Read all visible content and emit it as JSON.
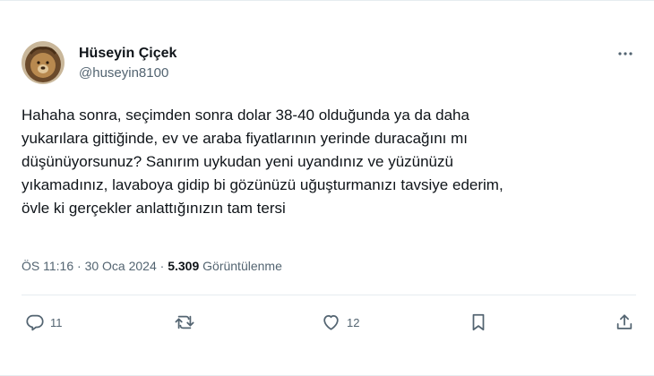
{
  "author": {
    "display_name": "Hüseyin Çiçek",
    "handle": "@huseyin8100",
    "avatar_icon": "lion-avatar"
  },
  "tweet": {
    "text": "Hahaha sonra, seçimden sonra dolar 38-40 olduğunda ya da daha\nyukarılara gittiğinde, ev ve araba fiyatlarının yerinde duracağını mı\ndüşünüyorsunuz? Sanırım uykudan yeni uyandınız ve yüzünüzü\nyıkamadınız, lavaboya gidip bi gözünüzü uğuşturmanızı tavsiye ederim,\növle ki gerçekler anlattığınızın tam tersi"
  },
  "meta": {
    "time": "ÖS 11:16",
    "separator1": " · ",
    "date": "30 Oca 2024",
    "separator2": " · ",
    "views": "5.309",
    "views_label": " Görüntülenme"
  },
  "actions": {
    "reply_count": "11",
    "retweet_count": "",
    "like_count": "12"
  },
  "colors": {
    "text_primary": "#0f1419",
    "text_secondary": "#536471",
    "border": "#e6ecf0"
  }
}
